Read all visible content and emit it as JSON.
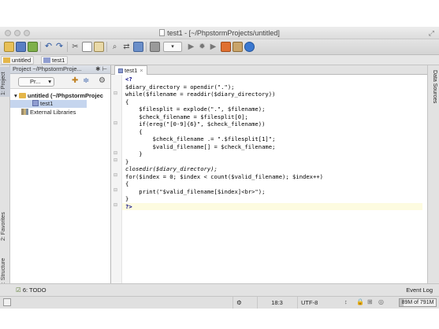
{
  "window": {
    "title": "test1 - [~/PhpstormProjects/untitled]"
  },
  "toolbar": {
    "run_config": "▾"
  },
  "navbar": {
    "crumbs": [
      "untitled",
      "test1"
    ]
  },
  "left_tabs": {
    "project": "1: Project",
    "favorites": "2: Favorites",
    "structure": "7: Structure"
  },
  "right_tabs": {
    "data_sources": "Data Sources"
  },
  "project_panel": {
    "header": "Project ~/PhpstormProje...",
    "view_combo": "Pr...",
    "tree": [
      {
        "label": "untitled (~/PhpstormProjec"
      },
      {
        "label": "test1"
      },
      {
        "label": "External Libraries"
      }
    ]
  },
  "editor": {
    "tab": "test1",
    "lines": [
      "<?",
      "$diary_directory = opendir(\".\");",
      "while($filename = readdir($diary_directory))",
      "{",
      "    $filesplit = explode(\".\", $filename);",
      "    $check_filename = $filesplit[0];",
      "    if(ereg(\"[0-9]{6}\", $check_filename))",
      "    {",
      "        $check_filename .= \".$filesplit[1]\";",
      "        $valid_filename[] = $check_filename;",
      "    }",
      "}",
      "closedir($diary_directory);",
      "for($index = 0; $index < count($valid_filename); $index++)",
      "{",
      "    print(\"$valid_filename[$index]<br>\");",
      "}",
      "?>"
    ]
  },
  "bottom": {
    "todo": "6: TODO",
    "event_log": "Event Log"
  },
  "status": {
    "position": "18:3",
    "encoding": "UTF-8",
    "memory": "89M of 791M",
    "memory_fraction": 0.11
  }
}
